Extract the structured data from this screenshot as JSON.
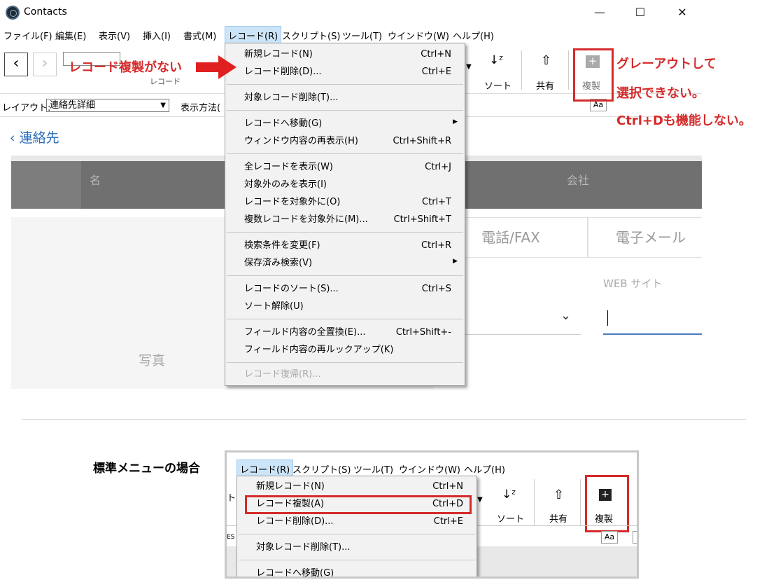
{
  "window": {
    "title": "Contacts",
    "minimize": "—",
    "maximize": "☐",
    "close": "✕"
  },
  "menubar": [
    "ファイル(F)",
    "編集(E)",
    "表示(V)",
    "挿入(I)",
    "書式(M)",
    "レコード(R)",
    "スクリプト(S)",
    "ツール(T)",
    "ウインドウ(W)",
    "ヘルプ(H)"
  ],
  "toolbar": {
    "record_label": "レコード",
    "sort_label": "ソート",
    "share_label": "共有",
    "duplicate_label": "複製"
  },
  "layoutbar": {
    "layout_label": "レイアウト:",
    "layout_value": "連絡先詳細",
    "view_label": "表示方法(",
    "aa": "Aa"
  },
  "content": {
    "breadcrumb": "連絡先",
    "name_header": "名",
    "company_header": "会社",
    "tab_phone": "電話/FAX",
    "tab_email": "電子メール",
    "web_label": "WEB サイト",
    "photo_label": "写真"
  },
  "record_menu": [
    {
      "label": "新規レコード(N)",
      "shortcut": "Ctrl+N"
    },
    {
      "label": "レコード削除(D)...",
      "shortcut": "Ctrl+E"
    },
    {
      "label": "対象レコード削除(T)...",
      "shortcut": ""
    },
    {
      "label": "レコードへ移動(G)",
      "shortcut": ""
    },
    {
      "label": "ウィンドウ内容の再表示(H)",
      "shortcut": "Ctrl+Shift+R"
    },
    {
      "label": "全レコードを表示(W)",
      "shortcut": "Ctrl+J"
    },
    {
      "label": "対象外のみを表示(I)",
      "shortcut": ""
    },
    {
      "label": "レコードを対象外に(O)",
      "shortcut": "Ctrl+T"
    },
    {
      "label": "複数レコードを対象外に(M)...",
      "shortcut": "Ctrl+Shift+T"
    },
    {
      "label": "検索条件を変更(F)",
      "shortcut": "Ctrl+R"
    },
    {
      "label": "保存済み検索(V)",
      "shortcut": ""
    },
    {
      "label": "レコードのソート(S)...",
      "shortcut": "Ctrl+S"
    },
    {
      "label": "ソート解除(U)",
      "shortcut": ""
    },
    {
      "label": "フィールド内容の全置換(E)...",
      "shortcut": "Ctrl+Shift+-"
    },
    {
      "label": "フィールド内容の再ルックアップ(K)",
      "shortcut": ""
    },
    {
      "label": "レコード復帰(R)...",
      "shortcut": ""
    }
  ],
  "annotations": {
    "no_duplicate": "レコード複製がない",
    "grayed_line1": "グレーアウトして",
    "grayed_line2": "選択できない。",
    "grayed_line3": "Ctrl+Dも機能しない。",
    "standard_menu": "標準メニューの場合"
  },
  "bottom": {
    "menubar": [
      "レコード(R)",
      "スクリプト(S)",
      "ツール(T)",
      "ウインドウ(W)",
      "ヘルプ(H)"
    ],
    "menu": [
      {
        "label": "新規レコード(N)",
        "shortcut": "Ctrl+N"
      },
      {
        "label": "レコード複製(A)",
        "shortcut": "Ctrl+D"
      },
      {
        "label": "レコード削除(D)...",
        "shortcut": "Ctrl+E"
      },
      {
        "label": "対象レコード削除(T)...",
        "shortcut": ""
      },
      {
        "label": "レコードへ移動(G)",
        "shortcut": ""
      }
    ],
    "sort_label": "ソート",
    "share_label": "共有",
    "duplicate_label": "複製",
    "aa": "Aa"
  },
  "colors": {
    "annotation_red": "#d52b2b",
    "menu_highlight": "#cce4f7",
    "link_blue": "#2b6cb8"
  }
}
